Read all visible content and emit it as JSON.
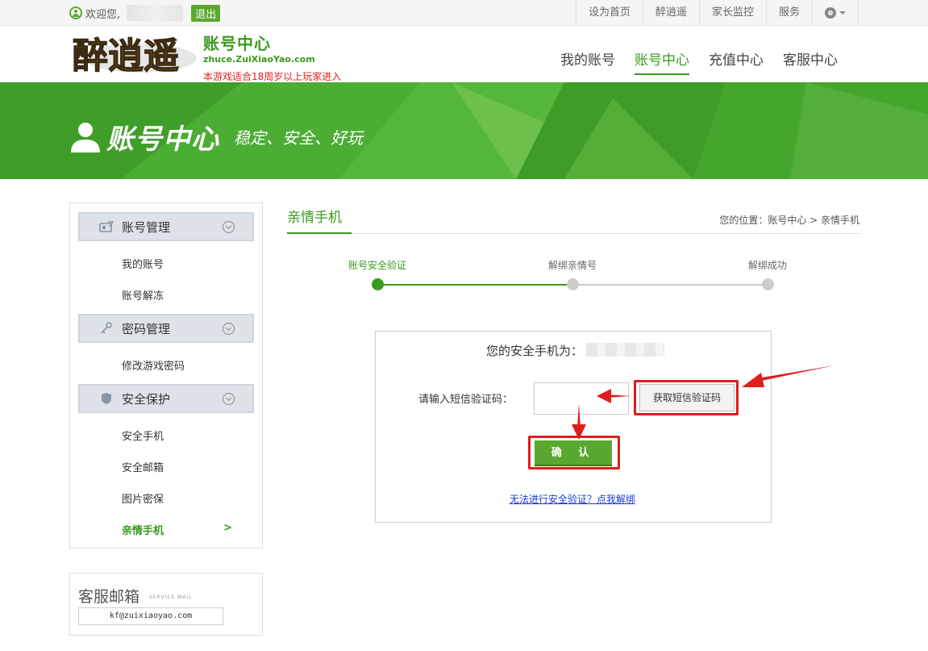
{
  "topbar": {
    "welcome": "欢迎您,",
    "logout": "退出",
    "links": [
      "设为首页",
      "醉逍遥",
      "家长监控",
      "服务"
    ]
  },
  "header": {
    "logo_art_text": "醉逍遥",
    "logo_title": "账号中心",
    "logo_url": "zhuce.ZuiXiaoYao.com",
    "age_note": "本游戏适合18周岁以上玩家进入",
    "nav": [
      "我的账号",
      "账号中心",
      "充值中心",
      "客服中心"
    ],
    "active_nav": "账号中心"
  },
  "banner": {
    "title": "账号中心",
    "slogan": "稳定、安全、好玩"
  },
  "sidebar": {
    "sections": [
      {
        "label": "账号管理",
        "icon": "account-card-icon",
        "items": [
          "我的账号",
          "账号解冻"
        ]
      },
      {
        "label": "密码管理",
        "icon": "key-icon",
        "items": [
          "修改游戏密码"
        ]
      },
      {
        "label": "安全保护",
        "icon": "shield-icon",
        "items": [
          "安全手机",
          "安全邮箱",
          "图片密保",
          "亲情手机"
        ]
      }
    ],
    "active_item": "亲情手机",
    "active_marker": ">"
  },
  "mailbox": {
    "title": "客服邮箱",
    "subtitle": "SERVICE MAIL",
    "email": "kf@zuixiaoyao.com"
  },
  "main": {
    "page_title": "亲情手机",
    "breadcrumb": "您的位置：账号中心 > 亲情手机",
    "steps": [
      "账号安全验证",
      "解绑亲情号",
      "解绑成功"
    ],
    "current_step": 1,
    "phone_label": "您的安全手机为：",
    "code_label": "请输入短信验证码：",
    "code_value": "",
    "sms_button": "获取短信验证码",
    "confirm_button": "确 认",
    "unbind_link": "无法进行安全验证？点我解绑"
  },
  "colors": {
    "brand_green": "#3a9a1e",
    "annotation_red": "#e01d1d",
    "link_blue": "#1a3bd9"
  }
}
